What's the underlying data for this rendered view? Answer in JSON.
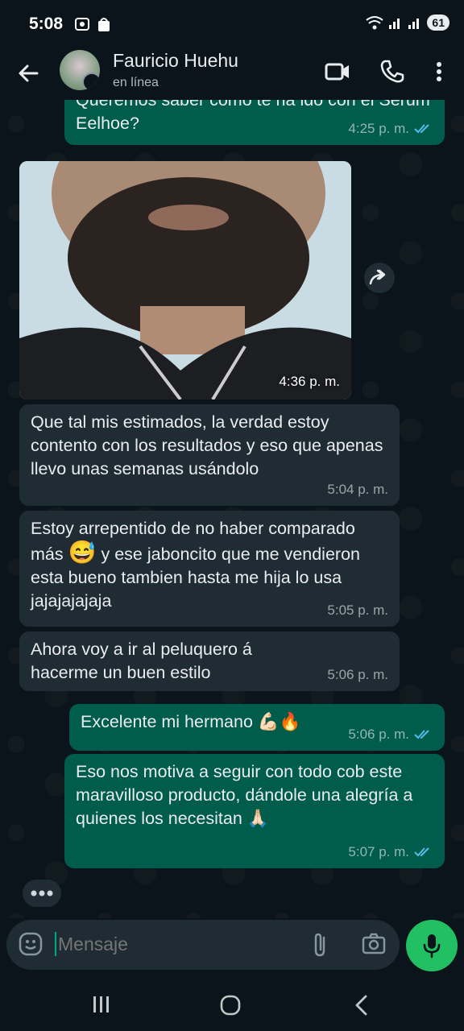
{
  "status": {
    "time": "5:08",
    "battery": "61"
  },
  "header": {
    "name": "Fauricio Huehu",
    "status": "en línea"
  },
  "messages": [
    {
      "text": "Queremos saber como te ha ido con el Serum Eelhoe?",
      "time": "4:25 p. m."
    },
    {
      "time": "4:36 p. m."
    },
    {
      "text": "Que tal mis estimados, la verdad estoy contento con los resultados y eso que apenas llevo unas semanas usándolo",
      "time": "5:04 p. m."
    },
    {
      "text_a": "Estoy arrepentido de no haber comparado más",
      "emoji": "😅",
      "text_b": "y ese jaboncito que me vendieron esta bueno tambien hasta me hija lo usa jajajajajaja",
      "time": "5:05 p. m."
    },
    {
      "text": "Ahora voy a ir al peluquero á hacerme un buen estilo",
      "time": "5:06 p. m."
    },
    {
      "text": "Excelente mi hermano 💪🏻🔥",
      "time": "5:06 p. m."
    },
    {
      "text": "Eso nos motiva a seguir con todo cob este maravilloso producto, dándole una alegría a quienes los necesitan 🙏🏻",
      "time": "5:07 p. m."
    }
  ],
  "composer": {
    "placeholder": "Mensaje"
  },
  "colors": {
    "incoming": "#202c33",
    "outgoing": "#005c4b",
    "accent": "#21c063",
    "ticks": "#53bdeb"
  },
  "icons": [
    "back-arrow-icon",
    "video-call-icon",
    "phone-icon",
    "more-vert-icon",
    "forward-icon",
    "emoji-icon",
    "attach-icon",
    "camera-icon",
    "mic-icon"
  ]
}
